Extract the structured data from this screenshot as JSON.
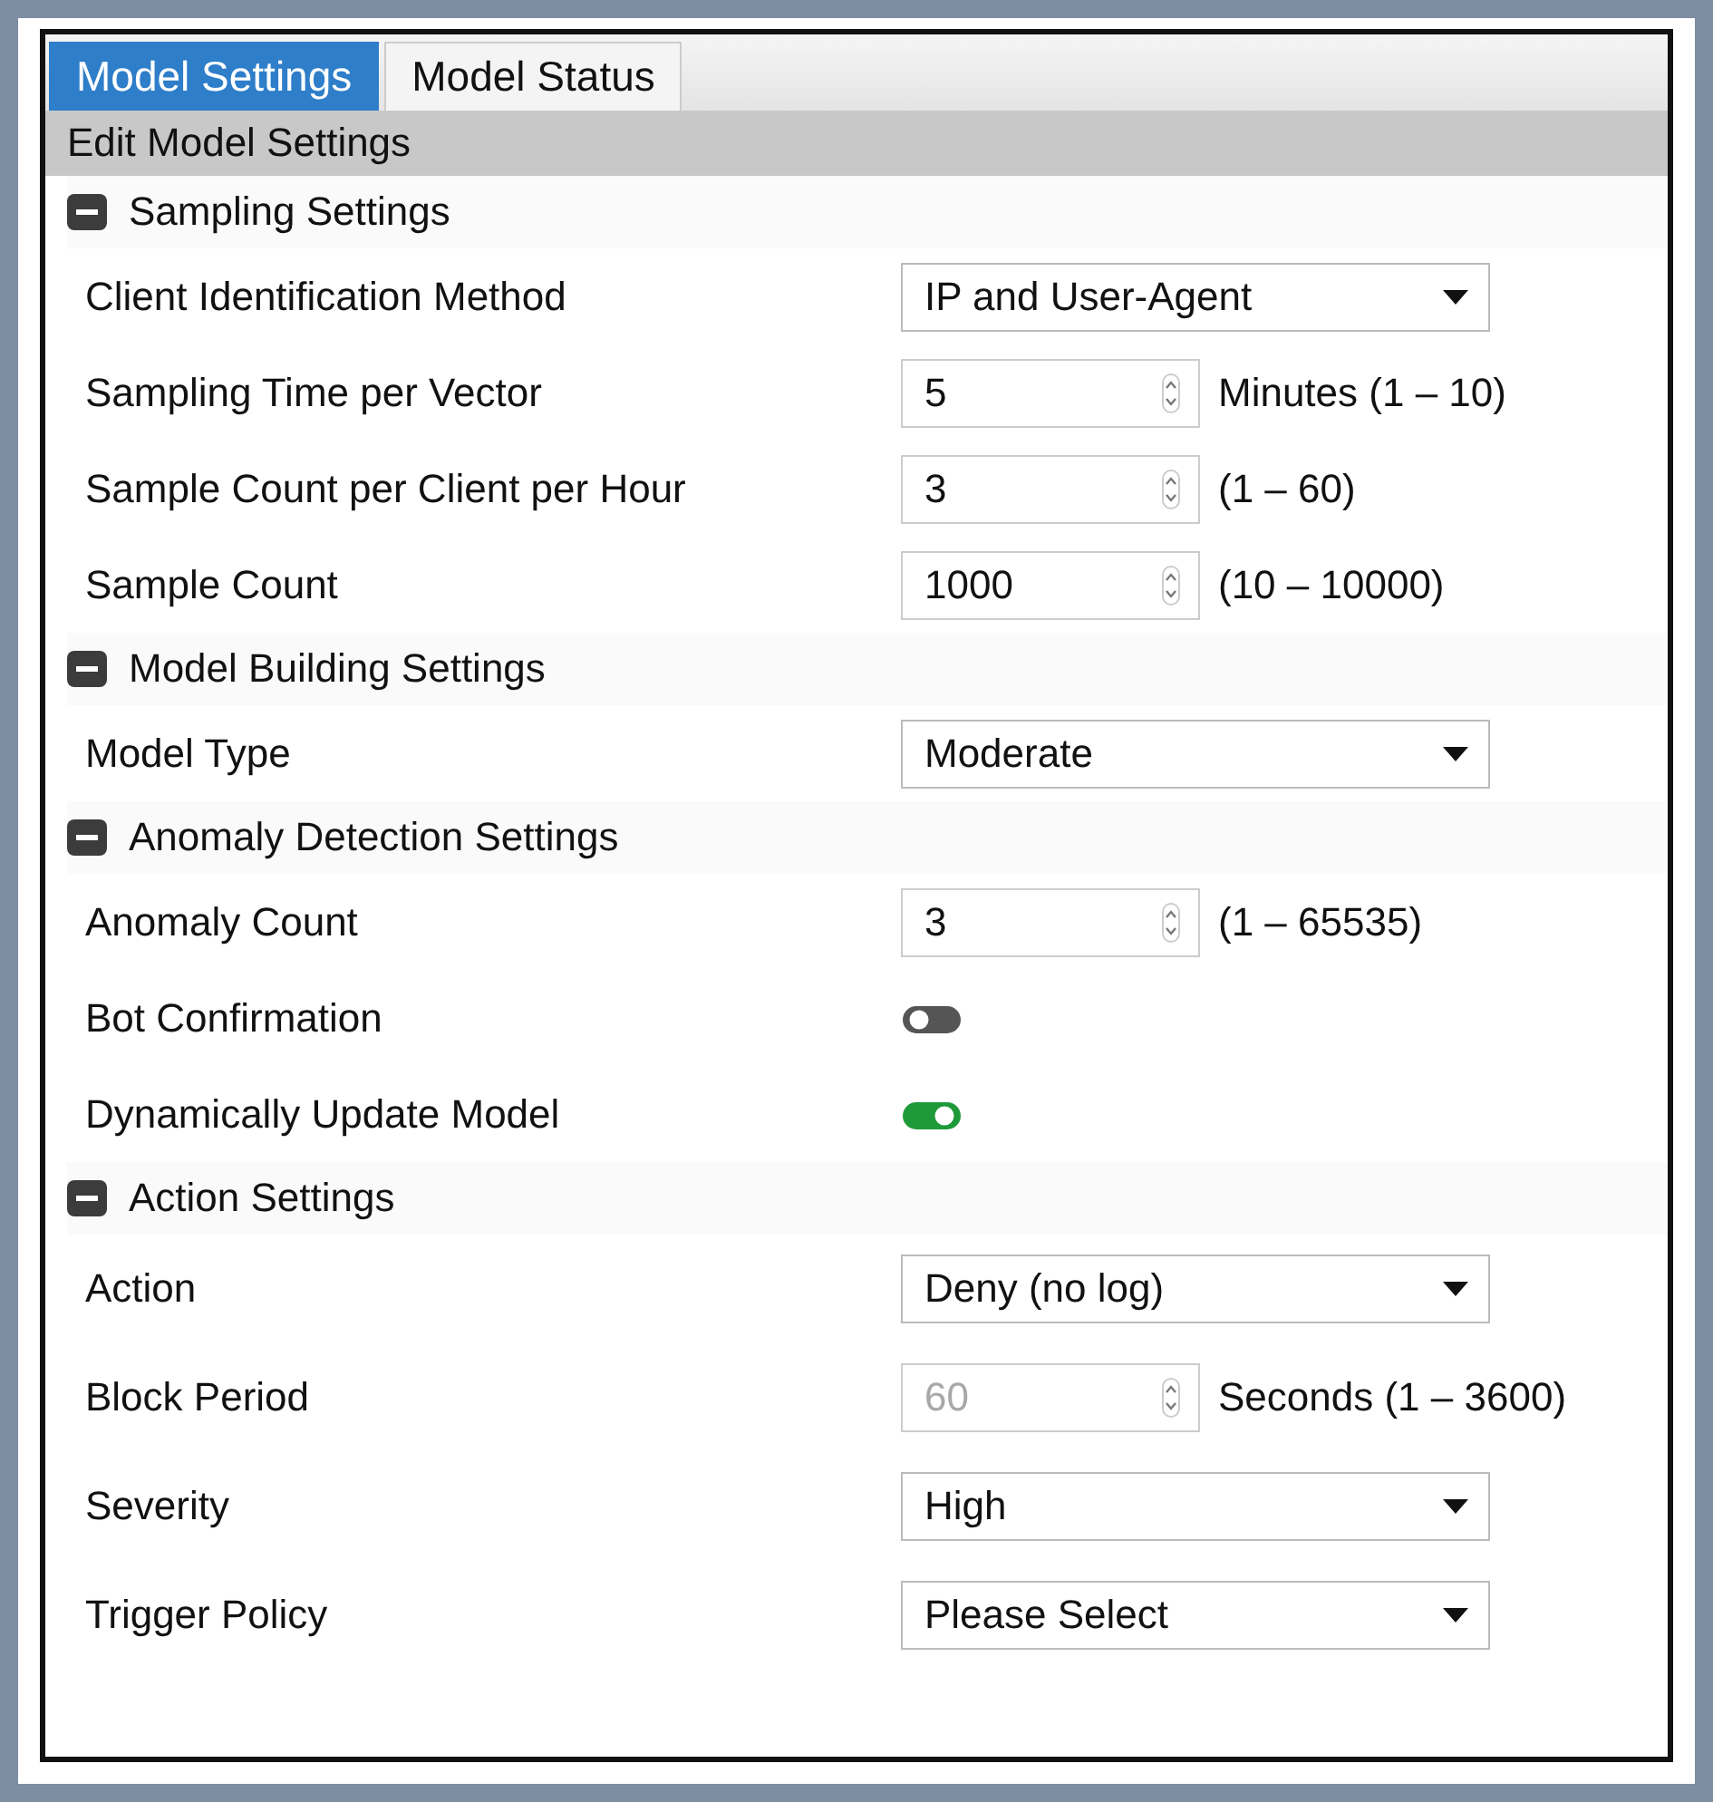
{
  "tabs": [
    {
      "label": "Model Settings",
      "selected": true
    },
    {
      "label": "Model Status",
      "selected": false
    }
  ],
  "panel_title": "Edit Model Settings",
  "sections": [
    {
      "title": "Sampling Settings",
      "expanded": true,
      "rows": [
        {
          "kind": "select",
          "label": "Client Identification Method",
          "value": "IP and User-Agent"
        },
        {
          "kind": "number",
          "label": "Sampling Time per Vector",
          "value": "5",
          "unit": "Minutes (1 – 10)",
          "disabled": false
        },
        {
          "kind": "number",
          "label": "Sample Count per Client per Hour",
          "value": "3",
          "unit": "(1 – 60)",
          "disabled": false
        },
        {
          "kind": "number",
          "label": "Sample Count",
          "value": "1000",
          "unit": "(10 – 10000)",
          "disabled": false
        }
      ]
    },
    {
      "title": "Model Building Settings",
      "expanded": true,
      "rows": [
        {
          "kind": "select",
          "label": "Model Type",
          "value": "Moderate"
        }
      ]
    },
    {
      "title": "Anomaly Detection Settings",
      "expanded": true,
      "rows": [
        {
          "kind": "number",
          "label": "Anomaly Count",
          "value": "3",
          "unit": "(1 – 65535)",
          "disabled": false
        },
        {
          "kind": "toggle",
          "label": "Bot Confirmation",
          "on": false
        },
        {
          "kind": "toggle",
          "label": "Dynamically Update Model",
          "on": true
        }
      ]
    },
    {
      "title": "Action Settings",
      "expanded": true,
      "rows": [
        {
          "kind": "select",
          "label": "Action",
          "value": "Deny (no log)"
        },
        {
          "kind": "number",
          "label": "Block Period",
          "value": "60",
          "unit": "Seconds (1 – 3600)",
          "disabled": true
        },
        {
          "kind": "select",
          "label": "Severity",
          "value": "High"
        },
        {
          "kind": "select",
          "label": "Trigger Policy",
          "value": "Please Select"
        }
      ]
    }
  ]
}
